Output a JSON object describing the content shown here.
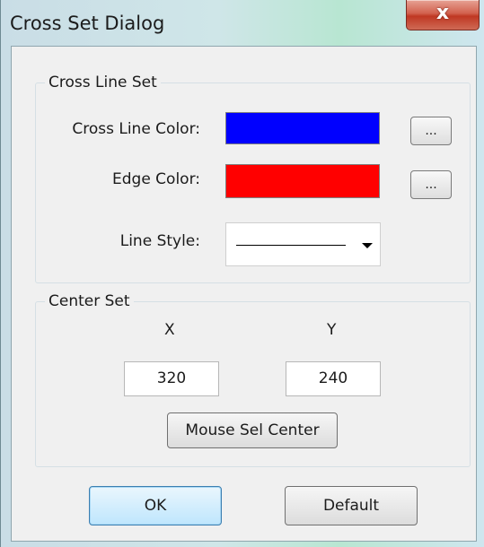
{
  "window": {
    "title": "Cross Set Dialog",
    "close_glyph": "x"
  },
  "cross_line_set": {
    "title": "Cross Line Set",
    "cross_line_color_label": "Cross Line Color:",
    "cross_line_color": "#0000ff",
    "edge_color_label": "Edge Color:",
    "edge_color": "#ff0000",
    "browse_label": "...",
    "line_style_label": "Line Style:",
    "line_style_value": "solid"
  },
  "center_set": {
    "title": "Center Set",
    "x_label": "X",
    "y_label": "Y",
    "x_value": "320",
    "y_value": "240",
    "mouse_sel_label": "Mouse Sel Center"
  },
  "buttons": {
    "ok_label": "OK",
    "default_label": "Default"
  }
}
